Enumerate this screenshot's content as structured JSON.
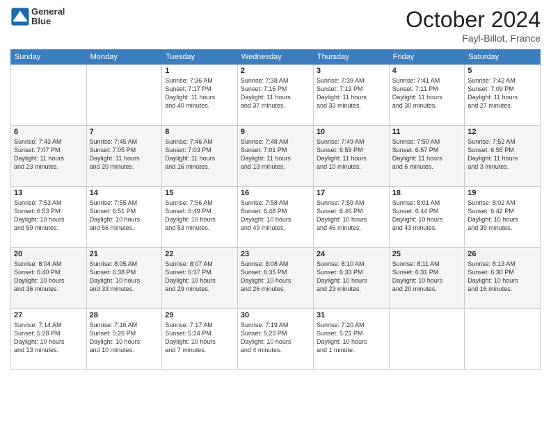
{
  "header": {
    "logo_line1": "General",
    "logo_line2": "Blue",
    "month": "October 2024",
    "location": "Fayl-Billot, France"
  },
  "days_of_week": [
    "Sunday",
    "Monday",
    "Tuesday",
    "Wednesday",
    "Thursday",
    "Friday",
    "Saturday"
  ],
  "weeks": [
    [
      {
        "day": "",
        "info": ""
      },
      {
        "day": "",
        "info": ""
      },
      {
        "day": "1",
        "info": "Sunrise: 7:36 AM\nSunset: 7:17 PM\nDaylight: 11 hours\nand 40 minutes."
      },
      {
        "day": "2",
        "info": "Sunrise: 7:38 AM\nSunset: 7:15 PM\nDaylight: 11 hours\nand 37 minutes."
      },
      {
        "day": "3",
        "info": "Sunrise: 7:39 AM\nSunset: 7:13 PM\nDaylight: 11 hours\nand 33 minutes."
      },
      {
        "day": "4",
        "info": "Sunrise: 7:41 AM\nSunset: 7:11 PM\nDaylight: 11 hours\nand 30 minutes."
      },
      {
        "day": "5",
        "info": "Sunrise: 7:42 AM\nSunset: 7:09 PM\nDaylight: 11 hours\nand 27 minutes."
      }
    ],
    [
      {
        "day": "6",
        "info": "Sunrise: 7:43 AM\nSunset: 7:07 PM\nDaylight: 11 hours\nand 23 minutes."
      },
      {
        "day": "7",
        "info": "Sunrise: 7:45 AM\nSunset: 7:05 PM\nDaylight: 11 hours\nand 20 minutes."
      },
      {
        "day": "8",
        "info": "Sunrise: 7:46 AM\nSunset: 7:03 PM\nDaylight: 11 hours\nand 16 minutes."
      },
      {
        "day": "9",
        "info": "Sunrise: 7:48 AM\nSunset: 7:01 PM\nDaylight: 11 hours\nand 13 minutes."
      },
      {
        "day": "10",
        "info": "Sunrise: 7:49 AM\nSunset: 6:59 PM\nDaylight: 11 hours\nand 10 minutes."
      },
      {
        "day": "11",
        "info": "Sunrise: 7:50 AM\nSunset: 6:57 PM\nDaylight: 11 hours\nand 6 minutes."
      },
      {
        "day": "12",
        "info": "Sunrise: 7:52 AM\nSunset: 6:55 PM\nDaylight: 11 hours\nand 3 minutes."
      }
    ],
    [
      {
        "day": "13",
        "info": "Sunrise: 7:53 AM\nSunset: 6:53 PM\nDaylight: 10 hours\nand 59 minutes."
      },
      {
        "day": "14",
        "info": "Sunrise: 7:55 AM\nSunset: 6:51 PM\nDaylight: 10 hours\nand 56 minutes."
      },
      {
        "day": "15",
        "info": "Sunrise: 7:56 AM\nSunset: 6:49 PM\nDaylight: 10 hours\nand 53 minutes."
      },
      {
        "day": "16",
        "info": "Sunrise: 7:58 AM\nSunset: 6:48 PM\nDaylight: 10 hours\nand 49 minutes."
      },
      {
        "day": "17",
        "info": "Sunrise: 7:59 AM\nSunset: 6:46 PM\nDaylight: 10 hours\nand 46 minutes."
      },
      {
        "day": "18",
        "info": "Sunrise: 8:01 AM\nSunset: 6:44 PM\nDaylight: 10 hours\nand 43 minutes."
      },
      {
        "day": "19",
        "info": "Sunrise: 8:02 AM\nSunset: 6:42 PM\nDaylight: 10 hours\nand 39 minutes."
      }
    ],
    [
      {
        "day": "20",
        "info": "Sunrise: 8:04 AM\nSunset: 6:40 PM\nDaylight: 10 hours\nand 36 minutes."
      },
      {
        "day": "21",
        "info": "Sunrise: 8:05 AM\nSunset: 6:38 PM\nDaylight: 10 hours\nand 33 minutes."
      },
      {
        "day": "22",
        "info": "Sunrise: 8:07 AM\nSunset: 6:37 PM\nDaylight: 10 hours\nand 29 minutes."
      },
      {
        "day": "23",
        "info": "Sunrise: 8:08 AM\nSunset: 6:35 PM\nDaylight: 10 hours\nand 26 minutes."
      },
      {
        "day": "24",
        "info": "Sunrise: 8:10 AM\nSunset: 6:33 PM\nDaylight: 10 hours\nand 23 minutes."
      },
      {
        "day": "25",
        "info": "Sunrise: 8:11 AM\nSunset: 6:31 PM\nDaylight: 10 hours\nand 20 minutes."
      },
      {
        "day": "26",
        "info": "Sunrise: 8:13 AM\nSunset: 6:30 PM\nDaylight: 10 hours\nand 16 minutes."
      }
    ],
    [
      {
        "day": "27",
        "info": "Sunrise: 7:14 AM\nSunset: 5:28 PM\nDaylight: 10 hours\nand 13 minutes."
      },
      {
        "day": "28",
        "info": "Sunrise: 7:16 AM\nSunset: 5:26 PM\nDaylight: 10 hours\nand 10 minutes."
      },
      {
        "day": "29",
        "info": "Sunrise: 7:17 AM\nSunset: 5:24 PM\nDaylight: 10 hours\nand 7 minutes."
      },
      {
        "day": "30",
        "info": "Sunrise: 7:19 AM\nSunset: 5:23 PM\nDaylight: 10 hours\nand 4 minutes."
      },
      {
        "day": "31",
        "info": "Sunrise: 7:20 AM\nSunset: 5:21 PM\nDaylight: 10 hours\nand 1 minute."
      },
      {
        "day": "",
        "info": ""
      },
      {
        "day": "",
        "info": ""
      }
    ]
  ]
}
